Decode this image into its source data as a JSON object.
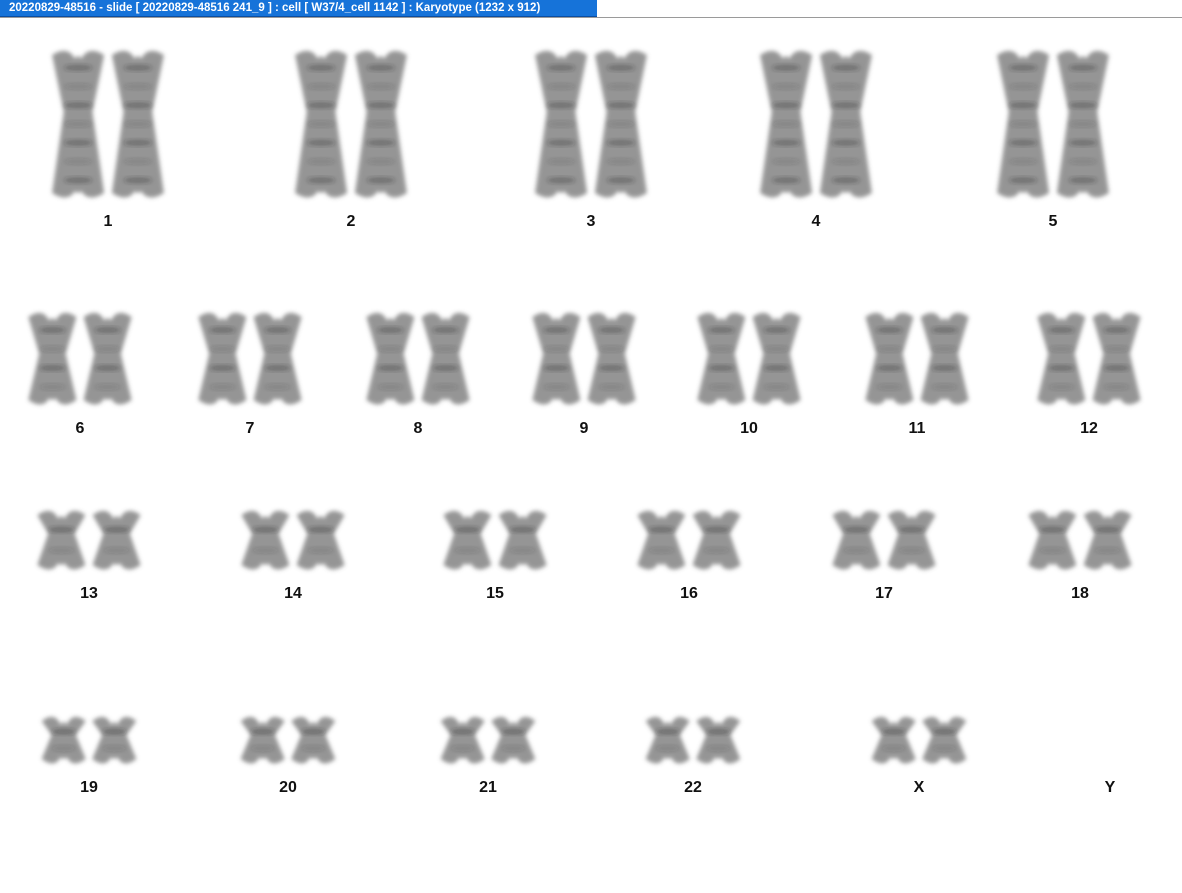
{
  "window": {
    "title": "20220829-48516 - slide [ 20220829-48516 241_9 ] : cell [ W37/4_cell 1142 ] : Karyotype  (1232 x 912)"
  },
  "colors": {
    "title_bar": "#1673d9",
    "title_text": "#ffffff",
    "chromosome": "#5c5c5c",
    "background": "#ffffff"
  },
  "karyotype": {
    "rows": [
      [
        "1",
        "2",
        "3",
        "4",
        "5"
      ],
      [
        "6",
        "7",
        "8",
        "9",
        "10",
        "11",
        "12"
      ],
      [
        "13",
        "14",
        "15",
        "16",
        "17",
        "18"
      ],
      [
        "19",
        "20",
        "21",
        "22",
        "X",
        "Y"
      ]
    ]
  }
}
